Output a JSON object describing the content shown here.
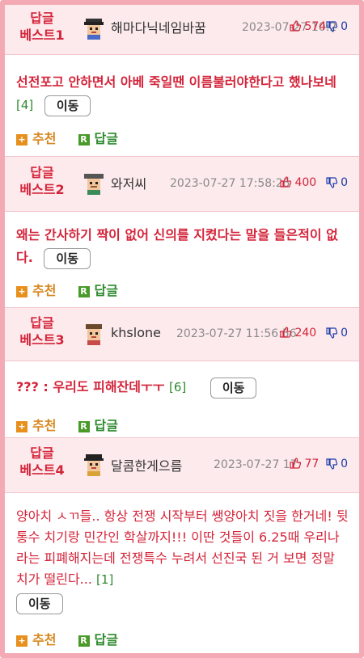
{
  "posts": [
    {
      "rank": "답글\n베스트1",
      "rank_line1": "답글",
      "rank_line2": "베스트1",
      "nick": "해마다닉네임바꿈",
      "date": "2023-07-27 10:2",
      "up": "574",
      "down": "0",
      "body": "선전포고 안하면서 아베 죽일땐 이름불러야한다고 했나보네",
      "count": "[4]"
    },
    {
      "rank_line1": "답글",
      "rank_line2": "베스트2",
      "nick": "와저씨",
      "date": "2023-07-27 17:58:25",
      "up": "400",
      "down": "0",
      "body": "왜는 간사하기 짝이 없어 신의를 지켰다는 말을 들은적이 없다.",
      "count": ""
    },
    {
      "rank_line1": "답글",
      "rank_line2": "베스트3",
      "nick": "khslone",
      "date": "2023-07-27 11:56:56",
      "up": "240",
      "down": "0",
      "body": "??? : 우리도 피해잔데ㅜㅜ",
      "count": "[6]"
    },
    {
      "rank_line1": "답글",
      "rank_line2": "베스트4",
      "nick": "달콤한게으름",
      "date": "2023-07-27 17:",
      "up": "77",
      "down": "0",
      "body": "양아치 ㅅㄲ들.. 항상 전쟁 시작부터 쌩양아치 짓을 한거네! 뒷통수 치기랑 민간인 학살까지!!! 이딴 것들이 6.25때 우리나라는 피폐해지는데 전쟁특수 누려서 선진국 된 거 보면 정말 치가 떨린다...",
      "count": "[1]"
    }
  ],
  "labels": {
    "move": "이동",
    "recommend": "추천",
    "reply": "답글",
    "recommend_icon": "+",
    "reply_icon": "R"
  },
  "icons": {
    "thumb_up": "thumbs-up-icon",
    "thumb_down": "thumbs-down-icon",
    "avatar": "pixel-avatar-icon"
  },
  "colors": {
    "accent_red": "#d4243a",
    "header_bg": "#fdeaec",
    "frame": "#f4aab4",
    "reply_green": "#2d8a2d",
    "recommend_orange": "#d8871e",
    "down_blue": "#1a3aa8"
  }
}
